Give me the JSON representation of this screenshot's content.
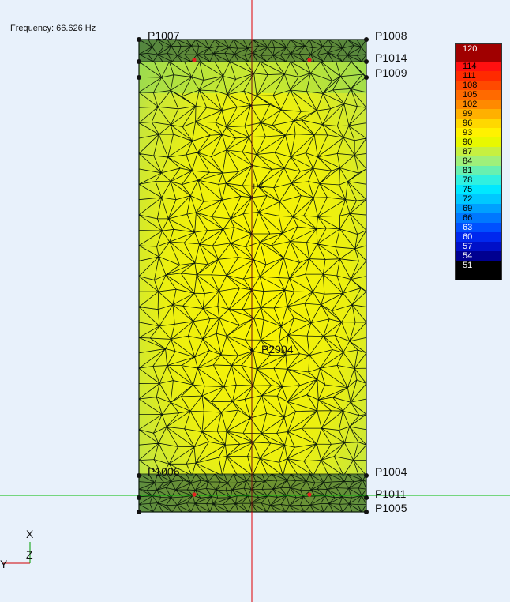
{
  "frequency_label": "Frequency: 66.626 Hz",
  "points": {
    "p1007": "P1007",
    "p1008": "P1008",
    "p1014": "P1014",
    "p1009": "P1009",
    "p2004": "P2004",
    "p1004": "P1004",
    "p1011": "P1011",
    "p1005": "P1005",
    "p1006": "P1006"
  },
  "legend": {
    "values": [
      "120",
      "114",
      "111",
      "108",
      "105",
      "102",
      "99",
      "96",
      "93",
      "90",
      "87",
      "84",
      "81",
      "78",
      "75",
      "72",
      "69",
      "66",
      "63",
      "60",
      "57",
      "54",
      "51"
    ]
  },
  "axes": {
    "x": "X",
    "z": "Z",
    "y": "Y"
  },
  "colors": {
    "background": "#e8f1fb",
    "mesh_edge": "#0b1a0b",
    "band": "#2f5e2f",
    "axis_red": "#e00000",
    "axis_green": "#00bb00"
  }
}
